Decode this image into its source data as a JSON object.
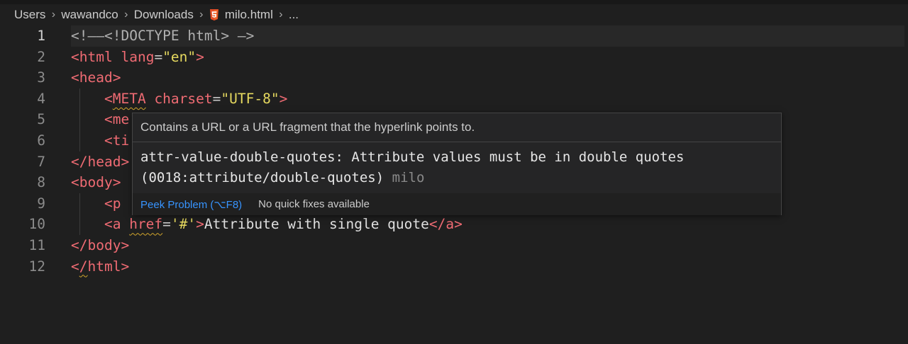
{
  "breadcrumb": {
    "items": [
      "Users",
      "wawandco",
      "Downloads",
      "milo.html",
      "..."
    ],
    "separator": "›"
  },
  "editor": {
    "current_line": 1,
    "lines": [
      {
        "num": "1",
        "tokens": [
          {
            "t": "<!—",
            "c": "cmt"
          },
          {
            "t": "—",
            "c": "cmt"
          },
          {
            "t": "<!DOCTYPE html> ",
            "c": "cmt"
          },
          {
            "t": "—>",
            "c": "cmt"
          }
        ]
      },
      {
        "num": "2",
        "tokens": [
          {
            "t": "<",
            "c": "tag"
          },
          {
            "t": "html",
            "c": "tag"
          },
          {
            "t": " ",
            "c": "txt"
          },
          {
            "t": "lang",
            "c": "attr"
          },
          {
            "t": "=",
            "c": "punct"
          },
          {
            "t": "\"en\"",
            "c": "str"
          },
          {
            "t": ">",
            "c": "tag"
          }
        ]
      },
      {
        "num": "3",
        "tokens": [
          {
            "t": "<head>",
            "c": "tag"
          }
        ]
      },
      {
        "num": "4",
        "tokens": [
          {
            "t": "    ",
            "c": "txt"
          },
          {
            "t": "<",
            "c": "tag"
          },
          {
            "t": "META",
            "c": "tag squiggle"
          },
          {
            "t": " ",
            "c": "txt"
          },
          {
            "t": "charset",
            "c": "attr"
          },
          {
            "t": "=",
            "c": "punct"
          },
          {
            "t": "\"UTF-8\"",
            "c": "str"
          },
          {
            "t": ">",
            "c": "tag"
          }
        ]
      },
      {
        "num": "5",
        "tokens": [
          {
            "t": "    ",
            "c": "txt"
          },
          {
            "t": "<me",
            "c": "tag"
          }
        ]
      },
      {
        "num": "6",
        "tokens": [
          {
            "t": "    ",
            "c": "txt"
          },
          {
            "t": "<ti",
            "c": "tag"
          }
        ]
      },
      {
        "num": "7",
        "tokens": [
          {
            "t": "</head>",
            "c": "tag"
          }
        ]
      },
      {
        "num": "8",
        "tokens": [
          {
            "t": "<body>",
            "c": "tag"
          }
        ]
      },
      {
        "num": "9",
        "tokens": [
          {
            "t": "    ",
            "c": "txt"
          },
          {
            "t": "<p",
            "c": "tag"
          }
        ]
      },
      {
        "num": "10",
        "tokens": [
          {
            "t": "    ",
            "c": "txt"
          },
          {
            "t": "<a",
            "c": "tag"
          },
          {
            "t": " ",
            "c": "txt"
          },
          {
            "t": "href",
            "c": "attr squiggle"
          },
          {
            "t": "=",
            "c": "punct"
          },
          {
            "t": "'#'",
            "c": "str"
          },
          {
            "t": ">",
            "c": "tag"
          },
          {
            "t": "Attribute with single quote",
            "c": "txt"
          },
          {
            "t": "</a>",
            "c": "tag"
          }
        ]
      },
      {
        "num": "11",
        "tokens": [
          {
            "t": "</body>",
            "c": "tag"
          }
        ]
      },
      {
        "num": "12",
        "tokens": [
          {
            "t": "<",
            "c": "tag"
          },
          {
            "t": "/",
            "c": "tag squiggle"
          },
          {
            "t": "html>",
            "c": "tag"
          }
        ]
      }
    ]
  },
  "hover": {
    "doc": "Contains a URL or a URL fragment that the hyperlink points to.",
    "message_line1": "attr-value-double-quotes: Attribute values must be in double quotes",
    "message_line2": "(0018:attribute/double-quotes)",
    "source": "milo",
    "peek_label": "Peek Problem (⌥F8)",
    "no_fix_label": "No quick fixes available"
  },
  "colors": {
    "background": "#1f1f1f",
    "tag": "#ef6b73",
    "string": "#e6d95f",
    "link": "#3794ff",
    "warning_squiggle": "#d4a72c",
    "html5_icon": "#e44d26"
  }
}
